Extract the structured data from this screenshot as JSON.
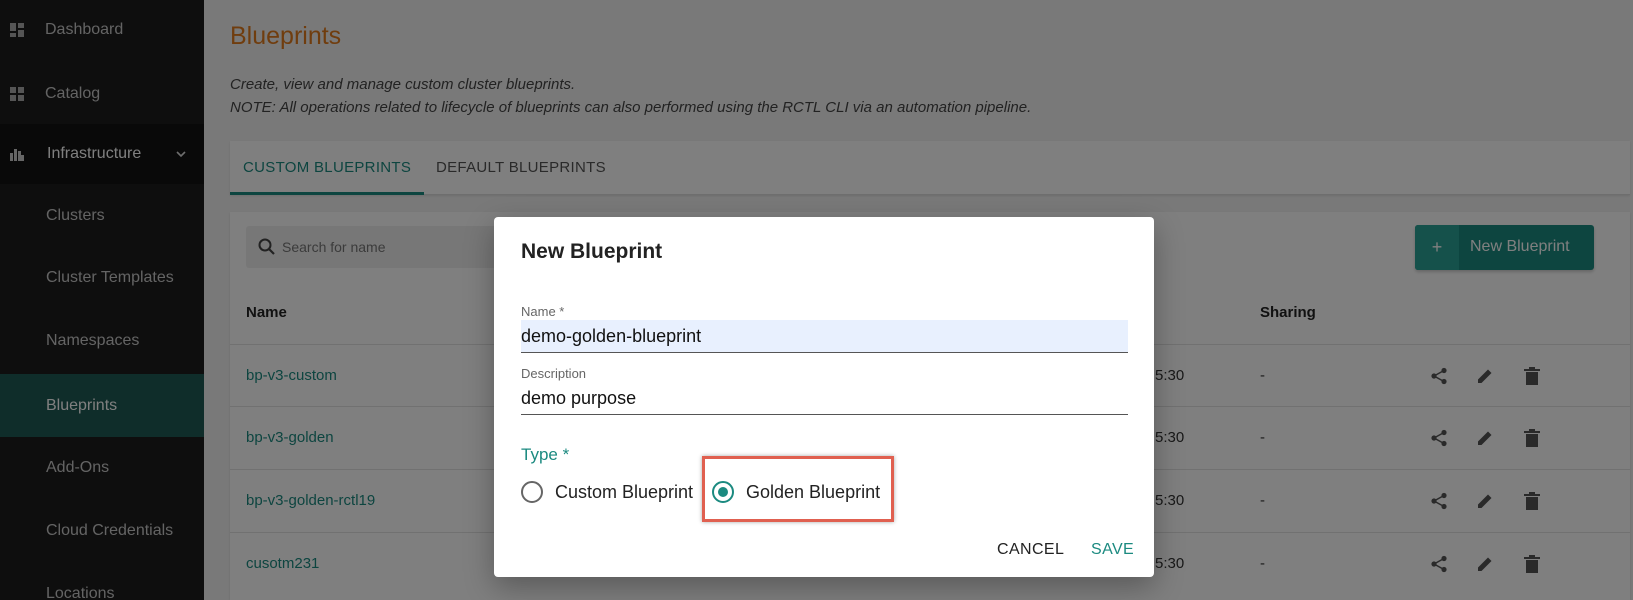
{
  "sidebar": {
    "items": [
      {
        "label": "Dashboard",
        "icon": "dashboard-icon"
      },
      {
        "label": "Catalog",
        "icon": "catalog-icon"
      },
      {
        "label": "Infrastructure",
        "icon": "infrastructure-icon"
      },
      {
        "label": "Clusters"
      },
      {
        "label": "Cluster Templates"
      },
      {
        "label": "Namespaces"
      },
      {
        "label": "Blueprints"
      },
      {
        "label": "Add-Ons"
      },
      {
        "label": "Cloud Credentials"
      },
      {
        "label": "Locations"
      }
    ],
    "active": "Blueprints",
    "expanded_section": "Infrastructure"
  },
  "page": {
    "title": "Blueprints",
    "desc1": "Create, view and manage custom cluster blueprints.",
    "desc2": "NOTE: All operations related to lifecycle of blueprints can also performed using the RCTL CLI via an automation pipeline."
  },
  "tabs": [
    {
      "label": "CUSTOM BLUEPRINTS",
      "active": true
    },
    {
      "label": "DEFAULT BLUEPRINTS",
      "active": false
    }
  ],
  "toolbar": {
    "search_placeholder": "Search for name",
    "new_button": "New Blueprint",
    "new_button_icon": "+"
  },
  "table": {
    "headers": {
      "name": "Name",
      "sharing": "Sharing"
    },
    "rows": [
      {
        "name": "bp-v3-custom",
        "modified": "5:30",
        "sharing": "-"
      },
      {
        "name": "bp-v3-golden",
        "modified": "5:30",
        "sharing": "-"
      },
      {
        "name": "bp-v3-golden-rctl19",
        "modified": "5:30",
        "sharing": "-"
      },
      {
        "name": "cusotm231",
        "modified": "5:30",
        "sharing": "-"
      }
    ]
  },
  "dialog": {
    "title": "New Blueprint",
    "name_label": "Name *",
    "name_value": "demo-golden-blueprint",
    "description_label": "Description",
    "description_value": "demo purpose",
    "type_label": "Type *",
    "options": [
      {
        "label": "Custom Blueprint",
        "checked": false
      },
      {
        "label": "Golden Blueprint",
        "checked": true
      }
    ],
    "cancel": "CANCEL",
    "save": "SAVE"
  },
  "colors": {
    "accent": "#1b8a80",
    "title": "#e07b1d",
    "sidebar": "#1c1c1c",
    "sidebar_active": "#1f5a55",
    "highlight": "#e06050"
  }
}
